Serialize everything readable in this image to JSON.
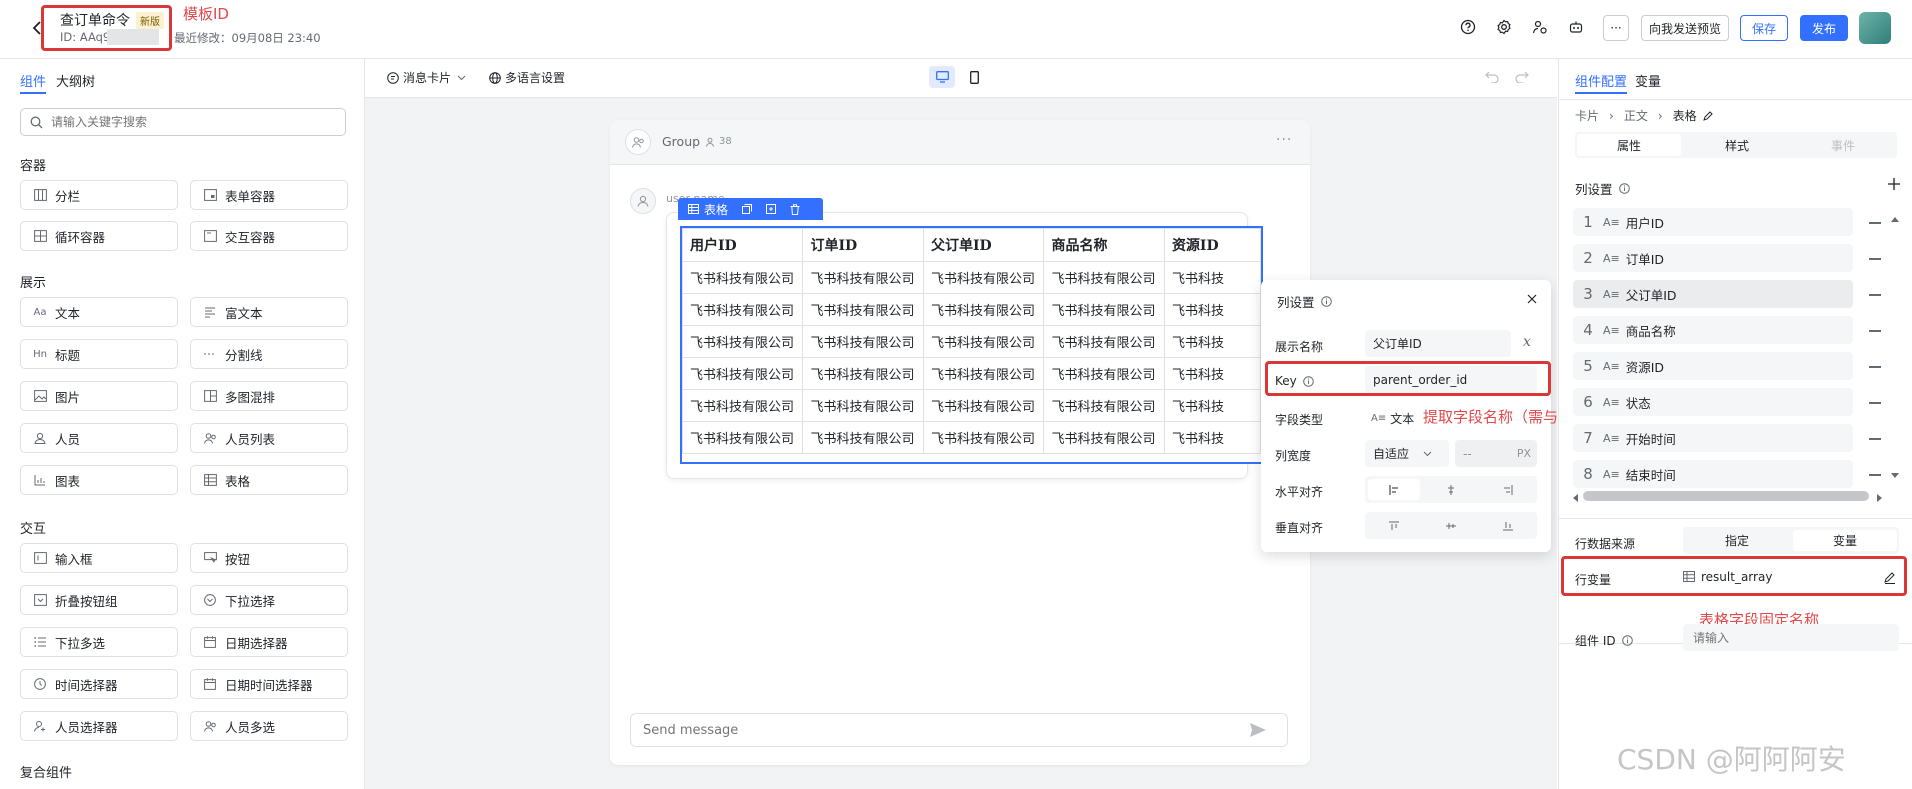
{
  "header": {
    "title": "查订单命令",
    "badge": "新版",
    "id_label": "ID: AAq9j",
    "modified": "最近修改：09月08日 23:40",
    "annotation": "模板ID",
    "send_preview": "向我发送预览",
    "save": "保存",
    "publish": "发布",
    "more": "···"
  },
  "left": {
    "tabs": [
      "组件",
      "大纲树"
    ],
    "search_placeholder": "请输入关键字搜索",
    "sections": [
      {
        "title": "容器",
        "items": [
          "分栏",
          "表单容器",
          "循环容器",
          "交互容器"
        ]
      },
      {
        "title": "展示",
        "items": [
          "文本",
          "富文本",
          "标题",
          "分割线",
          "图片",
          "多图混排",
          "人员",
          "人员列表",
          "图表",
          "表格"
        ]
      },
      {
        "title": "交互",
        "items": [
          "输入框",
          "按钮",
          "折叠按钮组",
          "下拉选择",
          "下拉多选",
          "日期选择器",
          "时间选择器",
          "日期时间选择器",
          "人员选择器",
          "人员多选"
        ]
      },
      {
        "title": "复合组件",
        "items": []
      }
    ]
  },
  "toolbar": {
    "message_card": "消息卡片",
    "multilang": "多语言设置"
  },
  "preview": {
    "group_name": "Group",
    "member_count": "38",
    "sender": "user name",
    "table_tag": "表格",
    "columns": [
      "用户ID",
      "订单ID",
      "父订单ID",
      "商品名称",
      "资源ID"
    ],
    "rows": [
      [
        "飞书科技有限公司",
        "飞书科技有限公司",
        "飞书科技有限公司",
        "飞书科技有限公司",
        "飞书科技"
      ],
      [
        "飞书科技有限公司",
        "飞书科技有限公司",
        "飞书科技有限公司",
        "飞书科技有限公司",
        "飞书科技"
      ],
      [
        "飞书科技有限公司",
        "飞书科技有限公司",
        "飞书科技有限公司",
        "飞书科技有限公司",
        "飞书科技"
      ],
      [
        "飞书科技有限公司",
        "飞书科技有限公司",
        "飞书科技有限公司",
        "飞书科技有限公司",
        "飞书科技"
      ],
      [
        "飞书科技有限公司",
        "飞书科技有限公司",
        "飞书科技有限公司",
        "飞书科技有限公司",
        "飞书科技"
      ],
      [
        "飞书科技有限公司",
        "飞书科技有限公司",
        "飞书科技有限公司",
        "飞书科技有限公司",
        "飞书科技"
      ]
    ],
    "message_placeholder": "Send message"
  },
  "col_popup": {
    "title": "列设置",
    "display_name_label": "展示名称",
    "display_name_value": "父订单ID",
    "key_label": "Key",
    "key_value": "parent_order_id",
    "field_type_label": "字段类型",
    "field_type_value": "文本",
    "width_label": "列宽度",
    "width_value": "自适应",
    "width_px_placeholder": "--",
    "width_unit": "PX",
    "halign_label": "水平对齐",
    "valign_label": "垂直对齐",
    "annotation": "提取字段名称（需与模板相同）"
  },
  "right": {
    "tabs": [
      "组件配置",
      "变量"
    ],
    "breadcrumb": [
      "卡片",
      "正文",
      "表格"
    ],
    "subtabs": [
      "属性",
      "样式",
      "事件"
    ],
    "col_settings_label": "列设置",
    "columns": [
      {
        "num": "1",
        "name": "用户ID"
      },
      {
        "num": "2",
        "name": "订单ID"
      },
      {
        "num": "3",
        "name": "父订单ID"
      },
      {
        "num": "4",
        "name": "商品名称"
      },
      {
        "num": "5",
        "name": "资源ID"
      },
      {
        "num": "6",
        "name": "状态"
      },
      {
        "num": "7",
        "name": "开始时间"
      },
      {
        "num": "8",
        "name": "结束时间"
      }
    ],
    "row_source_label": "行数据来源",
    "row_source_options": [
      "指定",
      "变量"
    ],
    "row_var_label": "行变量",
    "row_var_value": "result_array",
    "annotation": "表格字段固定名称",
    "component_id_label": "组件 ID",
    "component_id_placeholder": "请输入"
  },
  "watermark": "CSDN @阿阿阿安",
  "colors": {
    "accent": "#3370ff",
    "annotation": "#d93838"
  }
}
